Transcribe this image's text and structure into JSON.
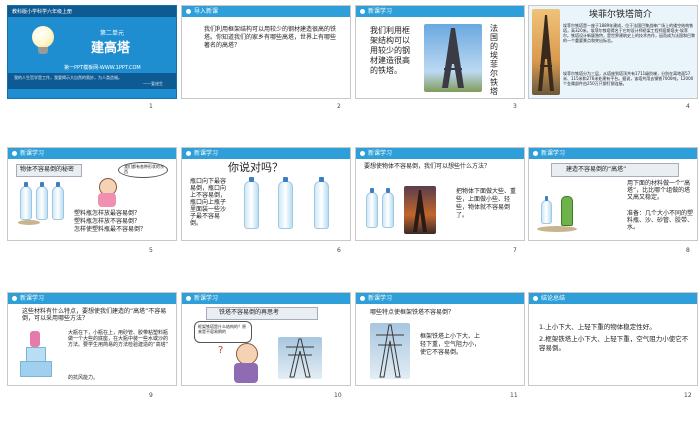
{
  "colors": {
    "accent": "#2e9fd8",
    "cover_bg": "#1f8ed0"
  },
  "slides": [
    {
      "num": "1",
      "header": "教科版小学科学六年级上册",
      "unit": "第二单元",
      "title": "建高塔",
      "site": "第一PPT模板网-WWW.1PPT.COM",
      "quote": "我的人生哲学是工作，我要揭示大自然的奥妙，为人类造福。",
      "quote_author": "——爱迪生"
    },
    {
      "num": "2",
      "bar": "导入新课",
      "text": "我们利用框架结构可以用较少的钢材建造很高的铁塔。你知道我们的家乡有哪些高塔，世界上有哪些著名的高塔？"
    },
    {
      "num": "3",
      "bar": "新课学习",
      "text_left": "我们利用框架结构可以用较少的钢材建造很高的铁塔。",
      "text_vertical": "法国的埃菲尔铁塔"
    },
    {
      "num": "4",
      "title": "埃菲尔铁塔简介",
      "p1": "埃菲尔铁塔是一座于1889年建成，位于法国巴黎战神广场上的镂空结构铁塔，高320米。埃菲尔铁塔得名于它的设计师桥梁工程师居斯塔夫·埃菲尔。铁塔设计新颖独特，是世界建筑史上的技术杰作，因而成为法国和巴黎的一个重要景点和突出标志。",
      "p2": "埃菲尔铁塔分为三层，从塔座到塔顶共有1711级阶梯，分别在离地面57米、115米和276米处建有平台。据说，该塔共用去钢铁7000吨，12000个金属部件由250万只铆钉铆连接。"
    },
    {
      "num": "5",
      "bar": "新课学习",
      "sign": "物体不容易倒的秘密",
      "bubble": "我们都有各种形状的东西",
      "q1": "塑料瓶怎样放最容易倒？",
      "q2": "塑料瓶怎样放不容易倒？",
      "q3": "怎样使塑料瓶最不容易倒？"
    },
    {
      "num": "6",
      "bar": "新课学习",
      "title": "你说对吗？",
      "text": "瓶口向下最容易倒，瓶口向上不容易倒，瓶口向上瓶子里面装一些沙子最不容易倒。"
    },
    {
      "num": "7",
      "bar": "新课学习",
      "top": "要想使物体不容易倒，我们可以想些什么方法？",
      "text": "把物体下面做大些、重些，上面做小些、轻些，物体就不容易倒了。"
    },
    {
      "num": "8",
      "bar": "新课学习",
      "sign": "建造不容易倒的“高塔”",
      "text": "用下面的材料做一个“高塔”，比比哪个组做的塔又高又稳定。",
      "materials": "准备：几个大小不同的塑料瓶、沙、砂管、胶带、水。"
    },
    {
      "num": "9",
      "bar": "新课学习",
      "top": "这些材料有什么特点，要想使我们建造的“高塔”不容易倒，可以采用哪些方法？",
      "text": "大瓶在下，小瓶在上，用砂管、胶带粘塑料瓶做一个大些的底座，在大瓶中装一些水或沙的方法。要学生用简易的方法检验建造的“高塔”",
      "tail": "的抗风能力。"
    },
    {
      "num": "10",
      "bar": "新课学习",
      "sign": "铁塔不容易倒的再思考",
      "bubble": "框架铁塔是什么结构的？原来是不容易倒的",
      "question": "?"
    },
    {
      "num": "11",
      "bar": "新课学习",
      "top": "哪些特点使框架铁塔不容易倒？",
      "text": "框架铁塔上小下大、上轻下重，空气阻力小，使它不容易倒。"
    },
    {
      "num": "12",
      "bar": "结论总结",
      "l1": "1.上小下大、上轻下重的物体稳定性好。",
      "l2": "2.框架铁塔上小下大、上轻下重，空气阻力小使它不容易倒。"
    }
  ]
}
